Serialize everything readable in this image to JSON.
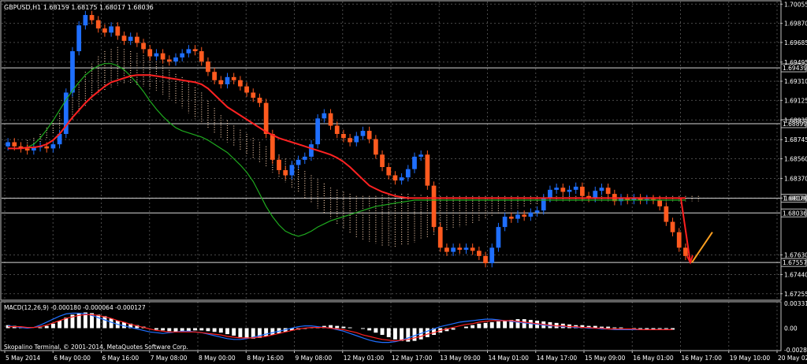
{
  "window": {
    "symbol_header": "GBPUSD,H1 1.68159 1.68175 1.68017 1.68036",
    "copyright": "Skopalino Terminal, © 2001-2014, MetaQuotes Software Corp."
  },
  "colors": {
    "background": "#000000",
    "grid": "#4a4a4a",
    "frame": "#bfbfbf",
    "text": "#ffffff",
    "bull": "#1f6fff",
    "bear": "#ff5a1f",
    "ma_slow": "#ff2222",
    "ma_fast": "#1faa1f",
    "cloud": "#f0c8a8",
    "macd_hist": "#ffffff",
    "macd_main": "#1f6fff",
    "macd_signal": "#ff2222",
    "arrow_down": "#ff2020",
    "arrow_up": "#ffa020",
    "marker_up": "#20e040"
  },
  "chart_data": [
    {
      "type": "line",
      "title": "GBPUSD,H1 1.68159 1.68175 1.68017 1.68036",
      "x_ticks": [
        "5 May 2014",
        "6 May 00:00",
        "6 May 16:00",
        "7 May 08:00",
        "8 May 00:00",
        "8 May 16:00",
        "9 May 08:00",
        "12 May 01:00",
        "12 May 17:00",
        "13 May 09:00",
        "14 May 01:00",
        "14 May 17:00",
        "15 May 09:00",
        "16 May 01:00",
        "16 May 17:00",
        "19 May 10:00",
        "20 May 02:00"
      ],
      "y_ticks": [
        "1.70055",
        "1.69870",
        "1.69685",
        "1.69495",
        "1.69310",
        "1.69125",
        "1.68935",
        "1.68745",
        "1.68560",
        "1.68370",
        "1.68180",
        "1.67630",
        "1.67440",
        "1.67255"
      ],
      "ylim": [
        1.672,
        1.7008
      ],
      "price_levels": [
        "1.69439",
        "1.68899",
        "1.68178",
        "1.68036",
        "1.67557"
      ],
      "close": [
        1.6872,
        1.6868,
        1.6866,
        1.6864,
        1.6867,
        1.6868,
        1.6866,
        1.687,
        1.688,
        1.692,
        1.696,
        1.6985,
        1.6995,
        1.699,
        1.6982,
        1.6978,
        1.6984,
        1.6975,
        1.697,
        1.6974,
        1.6968,
        1.6962,
        1.6955,
        1.6958,
        1.6952,
        1.695,
        1.6954,
        1.6958,
        1.6962,
        1.696,
        1.695,
        1.694,
        1.6932,
        1.6928,
        1.6935,
        1.6932,
        1.6926,
        1.692,
        1.6915,
        1.691,
        1.688,
        1.6855,
        1.6845,
        1.684,
        1.685,
        1.6855,
        1.6858,
        1.687,
        1.6895,
        1.69,
        1.6888,
        1.688,
        1.6876,
        1.6872,
        1.6878,
        1.6883,
        1.6875,
        1.686,
        1.6848,
        1.684,
        1.6835,
        1.6838,
        1.6846,
        1.6858,
        1.686,
        1.683,
        1.679,
        1.677,
        1.6766,
        1.677,
        1.6768,
        1.677,
        1.6767,
        1.6762,
        1.6755,
        1.677,
        1.679,
        1.68,
        1.6798,
        1.6802,
        1.68,
        1.6804,
        1.6806,
        1.6818,
        1.6826,
        1.6828,
        1.6824,
        1.6826,
        1.6829,
        1.682,
        1.6818,
        1.6825,
        1.6828,
        1.6822,
        1.6815,
        1.6818,
        1.6816,
        1.6818,
        1.6816,
        1.6817,
        1.6816,
        1.681,
        1.6795,
        1.6785,
        1.677,
        1.6762
      ],
      "open": [
        1.6868,
        1.6872,
        1.6868,
        1.6866,
        1.6864,
        1.6867,
        1.6868,
        1.6866,
        1.687,
        1.688,
        1.692,
        1.696,
        1.6985,
        1.6995,
        1.699,
        1.6982,
        1.6978,
        1.6984,
        1.6975,
        1.697,
        1.6974,
        1.6968,
        1.6962,
        1.6955,
        1.6958,
        1.6952,
        1.695,
        1.6954,
        1.6958,
        1.6962,
        1.696,
        1.695,
        1.694,
        1.6932,
        1.6928,
        1.6935,
        1.6932,
        1.6926,
        1.692,
        1.6915,
        1.691,
        1.688,
        1.6855,
        1.6845,
        1.684,
        1.685,
        1.6855,
        1.6858,
        1.687,
        1.6895,
        1.69,
        1.6888,
        1.688,
        1.6876,
        1.6872,
        1.6878,
        1.6883,
        1.6875,
        1.686,
        1.6848,
        1.684,
        1.6835,
        1.6838,
        1.6846,
        1.6858,
        1.686,
        1.683,
        1.679,
        1.677,
        1.6766,
        1.677,
        1.6768,
        1.677,
        1.6767,
        1.6762,
        1.6755,
        1.677,
        1.679,
        1.68,
        1.6798,
        1.6802,
        1.68,
        1.6804,
        1.6806,
        1.6818,
        1.6826,
        1.6828,
        1.6824,
        1.6826,
        1.6829,
        1.682,
        1.6818,
        1.6825,
        1.6828,
        1.6822,
        1.6815,
        1.6818,
        1.6816,
        1.6818,
        1.6816,
        1.6817,
        1.6816,
        1.681,
        1.6795,
        1.6785,
        1.677
      ],
      "ma_slow": [
        1.6866,
        1.6866,
        1.6866,
        1.6867,
        1.6867,
        1.6868,
        1.687,
        1.6874,
        1.688,
        1.6888,
        1.6896,
        1.6903,
        1.691,
        1.6916,
        1.6921,
        1.6926,
        1.693,
        1.6932,
        1.6934,
        1.6936,
        1.6937,
        1.6937,
        1.6937,
        1.6936,
        1.6935,
        1.6934,
        1.6933,
        1.6932,
        1.6931,
        1.693,
        1.6928,
        1.6924,
        1.6918,
        1.6912,
        1.6906,
        1.6902,
        1.6898,
        1.6894,
        1.689,
        1.6886,
        1.6882,
        1.6879,
        1.6876,
        1.6874,
        1.6872,
        1.687,
        1.6868,
        1.6866,
        1.6864,
        1.6862,
        1.686,
        1.6857,
        1.6853,
        1.6848,
        1.6842,
        1.6836,
        1.683,
        1.6827,
        1.6824,
        1.6822,
        1.682,
        1.6819,
        1.6818,
        1.6818,
        1.6818,
        1.6818,
        1.6818,
        1.6818,
        1.6818,
        1.6818,
        1.6818,
        1.6818,
        1.6818,
        1.6818,
        1.6818,
        1.6818,
        1.6818,
        1.6818,
        1.6818,
        1.6818,
        1.6818,
        1.6818,
        1.6818,
        1.6818,
        1.6818,
        1.6818,
        1.6818,
        1.6818,
        1.6818,
        1.6818,
        1.6818,
        1.6818,
        1.6818,
        1.6818,
        1.6818,
        1.6818,
        1.6818,
        1.6818,
        1.6818,
        1.6818,
        1.6818,
        1.6818,
        1.6818,
        1.6818,
        1.6818,
        1.6818
      ],
      "ma_fast": [
        1.6866,
        1.6866,
        1.6866,
        1.6867,
        1.687,
        1.6876,
        1.6884,
        1.6893,
        1.6903,
        1.6913,
        1.6922,
        1.693,
        1.6937,
        1.6942,
        1.6946,
        1.6948,
        1.6948,
        1.6946,
        1.6942,
        1.6936,
        1.6929,
        1.6921,
        1.6912,
        1.6904,
        1.6897,
        1.6891,
        1.6886,
        1.6883,
        1.6881,
        1.6879,
        1.6877,
        1.6874,
        1.687,
        1.6866,
        1.6862,
        1.6856,
        1.685,
        1.6843,
        1.6834,
        1.6822,
        1.681,
        1.68,
        1.6792,
        1.6786,
        1.6783,
        1.6781,
        1.6783,
        1.6786,
        1.679,
        1.6793,
        1.6796,
        1.6798,
        1.68,
        1.6802,
        1.6804,
        1.6806,
        1.6808,
        1.681,
        1.6811,
        1.6812,
        1.6813,
        1.6814,
        1.6815,
        1.6816,
        1.6816,
        1.6816,
        1.6816,
        1.6816,
        1.6816,
        1.6816,
        1.6816,
        1.6816,
        1.6816,
        1.6816,
        1.6816,
        1.6816,
        1.6816,
        1.6816,
        1.6816,
        1.6816,
        1.6816,
        1.6816,
        1.6816,
        1.6816,
        1.6816,
        1.6816,
        1.6816,
        1.6816,
        1.6816,
        1.6816,
        1.6816,
        1.6816,
        1.6816,
        1.6816,
        1.6816,
        1.6816,
        1.6816,
        1.6816,
        1.6816,
        1.6816,
        1.6816,
        1.6816,
        1.6816,
        1.6816,
        1.6816,
        1.6816
      ],
      "cloud_upper": [
        1.6872,
        1.6874,
        1.6876,
        1.688,
        1.6886,
        1.6893,
        1.69,
        1.691,
        1.692,
        1.693,
        1.694,
        1.6948,
        1.6955,
        1.696,
        1.6962,
        1.6964,
        1.6962,
        1.696,
        1.6958,
        1.6956,
        1.6954,
        1.695,
        1.6946,
        1.6942,
        1.6938,
        1.6935,
        1.693,
        1.6925,
        1.692,
        1.6912,
        1.6905,
        1.6898,
        1.6893,
        1.6888,
        1.6884,
        1.688,
        1.6876,
        1.6872,
        1.6868,
        1.6864,
        1.686,
        1.6856,
        1.6852,
        1.6848,
        1.6844,
        1.684,
        1.6836,
        1.6832,
        1.6828,
        1.6826,
        1.6824,
        1.6822,
        1.682,
        1.682,
        1.682,
        1.682,
        1.6821,
        1.6821,
        1.6822,
        1.6822,
        1.6822,
        1.6821,
        1.6821,
        1.682,
        1.682,
        1.682,
        1.682,
        1.682,
        1.682,
        1.682,
        1.682,
        1.682,
        1.682,
        1.682,
        1.682,
        1.682,
        1.682,
        1.682,
        1.682,
        1.682,
        1.682,
        1.682,
        1.682,
        1.682,
        1.682,
        1.682,
        1.682,
        1.682,
        1.682,
        1.682,
        1.682,
        1.682,
        1.682,
        1.682,
        1.682,
        1.682,
        1.682,
        1.682,
        1.682,
        1.682,
        1.682,
        1.682,
        1.682,
        1.682,
        1.682,
        1.682
      ],
      "cloud_lower": [
        1.6866,
        1.6868,
        1.687,
        1.6872,
        1.6876,
        1.688,
        1.6884,
        1.6889,
        1.6894,
        1.69,
        1.6906,
        1.6912,
        1.6918,
        1.6922,
        1.6925,
        1.6927,
        1.6928,
        1.6928,
        1.6927,
        1.6926,
        1.6924,
        1.6922,
        1.6918,
        1.6914,
        1.691,
        1.6905,
        1.69,
        1.6895,
        1.689,
        1.6885,
        1.688,
        1.6876,
        1.6872,
        1.6868,
        1.6864,
        1.686,
        1.6856,
        1.6852,
        1.6848,
        1.6843,
        1.6838,
        1.6833,
        1.6828,
        1.6823,
        1.6818,
        1.6813,
        1.6808,
        1.6803,
        1.6798,
        1.6793,
        1.6788,
        1.6784,
        1.678,
        1.6778,
        1.6776,
        1.6774,
        1.6772,
        1.6771,
        1.6771,
        1.6772,
        1.6773,
        1.6775,
        1.6778,
        1.678,
        1.6782,
        1.6784,
        1.6786,
        1.6788,
        1.679,
        1.6792,
        1.6794,
        1.6796,
        1.6798,
        1.68,
        1.6802,
        1.6804,
        1.6806,
        1.6808,
        1.681,
        1.6811,
        1.6812,
        1.6813,
        1.6814,
        1.6815,
        1.6815,
        1.6815,
        1.6815,
        1.6815,
        1.6815,
        1.6815,
        1.6815,
        1.6815,
        1.6815,
        1.6815,
        1.6815,
        1.6815,
        1.6815,
        1.6815,
        1.6815,
        1.6815,
        1.6815,
        1.6815,
        1.6815,
        1.6815,
        1.6815,
        1.6815
      ],
      "annotations": [
        {
          "kind": "arrow_down",
          "from": 1.6818,
          "to": 1.67557
        },
        {
          "kind": "arrow_up",
          "from": 1.67557,
          "to": 1.6785
        }
      ]
    },
    {
      "type": "bar",
      "title": "MACD(12,26,9) -0.000180 -0.000064 -0.000127",
      "y_ticks": [
        "0.003315",
        "0.00",
        "-0.002894"
      ],
      "ylim": [
        -0.002894,
        0.003315
      ],
      "histogram": [
        0.0004,
        0.0003,
        0.0002,
        0.0001,
        0.0,
        0.0001,
        0.0003,
        0.0006,
        0.001,
        0.0014,
        0.0018,
        0.002,
        0.0021,
        0.002,
        0.0018,
        0.0016,
        0.0013,
        0.001,
        0.0008,
        0.0006,
        0.0004,
        0.0002,
        0.0,
        -0.0002,
        -0.0003,
        -0.0004,
        -0.0005,
        -0.0005,
        -0.0004,
        -0.0003,
        -0.0003,
        -0.0004,
        -0.0005,
        -0.0006,
        -0.0008,
        -0.001,
        -0.0012,
        -0.0013,
        -0.0014,
        -0.0013,
        -0.0011,
        -0.0009,
        -0.0007,
        -0.0005,
        -0.0003,
        -0.0002,
        -0.0001,
        0.0001,
        0.0002,
        0.0003,
        0.0004,
        0.0003,
        0.0002,
        0.0001,
        0.0,
        -0.0001,
        -0.0003,
        -0.0006,
        -0.0009,
        -0.0012,
        -0.0015,
        -0.0017,
        -0.0018,
        -0.0017,
        -0.0015,
        -0.0012,
        -0.0009,
        -0.0006,
        -0.0004,
        -0.0002,
        0.0,
        0.0002,
        0.0004,
        0.0006,
        0.0007,
        0.0008,
        0.0009,
        0.001,
        0.0011,
        0.0012,
        0.0012,
        0.0011,
        0.001,
        0.0009,
        0.0008,
        0.0007,
        0.0006,
        0.0005,
        0.0004,
        0.0004,
        0.0003,
        0.0003,
        0.0002,
        0.0002,
        0.0001,
        0.0001,
        0.0,
        -0.0001,
        -0.0001,
        -0.0002,
        -0.0002,
        -0.0001,
        -0.0001,
        -0.0002
      ],
      "macd_main": [
        0.0003,
        0.0002,
        0.0001,
        0.0,
        0.0001,
        0.0004,
        0.0008,
        0.0012,
        0.0016,
        0.0019,
        0.002,
        0.002,
        0.0019,
        0.0017,
        0.0014,
        0.0011,
        0.0008,
        0.0005,
        0.0003,
        0.0001,
        -0.0001,
        -0.0003,
        -0.0005,
        -0.0006,
        -0.0007,
        -0.0006,
        -0.0005,
        -0.0004,
        -0.0004,
        -0.0005,
        -0.0006,
        -0.0008,
        -0.001,
        -0.0012,
        -0.0014,
        -0.0015,
        -0.0015,
        -0.0014,
        -0.0012,
        -0.001,
        -0.0008,
        -0.0006,
        -0.0004,
        -0.0002,
        0.0,
        0.0002,
        0.0003,
        0.0003,
        0.0002,
        0.0001,
        0.0,
        -0.0002,
        -0.0004,
        -0.0007,
        -0.001,
        -0.0013,
        -0.0016,
        -0.0018,
        -0.0019,
        -0.0019,
        -0.0018,
        -0.0016,
        -0.0013,
        -0.001,
        -0.0007,
        -0.0004,
        -0.0001,
        0.0002,
        0.0004,
        0.0006,
        0.0008,
        0.0009,
        0.001,
        0.0011,
        0.0012,
        0.0012,
        0.0011,
        0.001,
        0.0009,
        0.0008,
        0.0007,
        0.0006,
        0.0005,
        0.0004,
        0.0003,
        0.0003,
        0.0002,
        0.0002,
        0.0001,
        0.0001,
        0.0,
        0.0,
        -0.0001,
        -0.0001,
        -0.0002,
        -0.0002,
        -0.0002,
        -0.0002,
        -0.0002,
        -0.0002,
        -0.0002,
        -0.0002,
        -0.0002,
        -0.0002
      ],
      "macd_signal": [
        0.0002,
        0.0002,
        0.0002,
        0.0001,
        0.0001,
        0.0002,
        0.0004,
        0.0007,
        0.001,
        0.0013,
        0.0015,
        0.0017,
        0.0018,
        0.0018,
        0.0017,
        0.0015,
        0.0013,
        0.001,
        0.0008,
        0.0005,
        0.0003,
        0.0001,
        -0.0001,
        -0.0003,
        -0.0004,
        -0.0005,
        -0.0005,
        -0.0005,
        -0.0005,
        -0.0005,
        -0.0006,
        -0.0007,
        -0.0008,
        -0.0009,
        -0.0011,
        -0.0012,
        -0.0013,
        -0.0013,
        -0.0013,
        -0.0012,
        -0.0011,
        -0.0009,
        -0.0007,
        -0.0005,
        -0.0003,
        -0.0001,
        0.0,
        0.0001,
        0.0001,
        0.0001,
        0.0,
        -0.0001,
        -0.0002,
        -0.0004,
        -0.0006,
        -0.0009,
        -0.0011,
        -0.0013,
        -0.0015,
        -0.0016,
        -0.0017,
        -0.0016,
        -0.0015,
        -0.0013,
        -0.0011,
        -0.0008,
        -0.0006,
        -0.0003,
        -0.0001,
        0.0001,
        0.0003,
        0.0005,
        0.0006,
        0.0008,
        0.0009,
        0.001,
        0.001,
        0.001,
        0.001,
        0.0009,
        0.0008,
        0.0007,
        0.0006,
        0.0005,
        0.0004,
        0.0003,
        0.0003,
        0.0002,
        0.0002,
        0.0001,
        0.0001,
        0.0,
        0.0,
        -0.0001,
        -0.0001,
        -0.0001,
        -0.0001,
        -0.0001,
        -0.0002,
        -0.0002,
        -0.0002,
        -0.0002,
        -0.0002,
        -0.0002
      ]
    }
  ]
}
